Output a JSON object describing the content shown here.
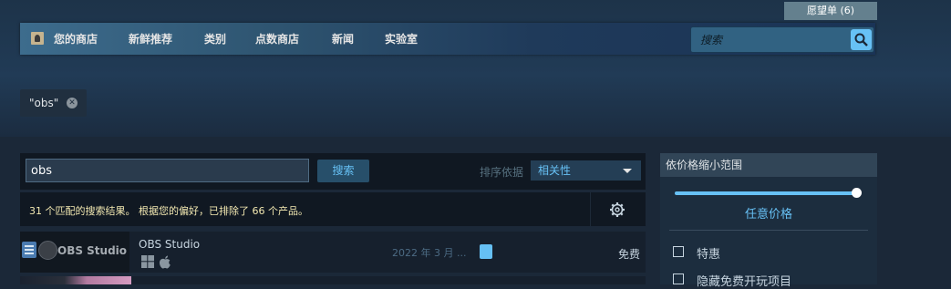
{
  "header": {
    "wishlist_label": "愿望单 (6)",
    "nav_items": [
      "您的商店",
      "新鲜推荐",
      "类别",
      "点数商店",
      "新闻",
      "实验室"
    ],
    "search_placeholder": "搜索"
  },
  "filter_tag": {
    "label": "\"obs\""
  },
  "search": {
    "term_value": "obs",
    "button_label": "搜索",
    "sort_label": "排序依据",
    "sort_value": "相关性"
  },
  "results": {
    "summary": "31 个匹配的搜索结果。 根据您的偏好，已排除了 66 个产品。"
  },
  "rows": [
    {
      "capsule_text": "OBS Studio",
      "title": "OBS Studio",
      "platforms": [
        "windows-icon",
        "apple-icon"
      ],
      "release_date": "2022 年 3 月 ...",
      "price": "免费"
    }
  ],
  "price_filter": {
    "header": "依价格缩小范围",
    "price_label": "任意价格",
    "options": [
      "特惠",
      "隐藏免费开玩项目"
    ]
  },
  "colors": {
    "accent": "#67c1f5",
    "background": "#1b2838",
    "results_text": "#f2e8b1"
  }
}
